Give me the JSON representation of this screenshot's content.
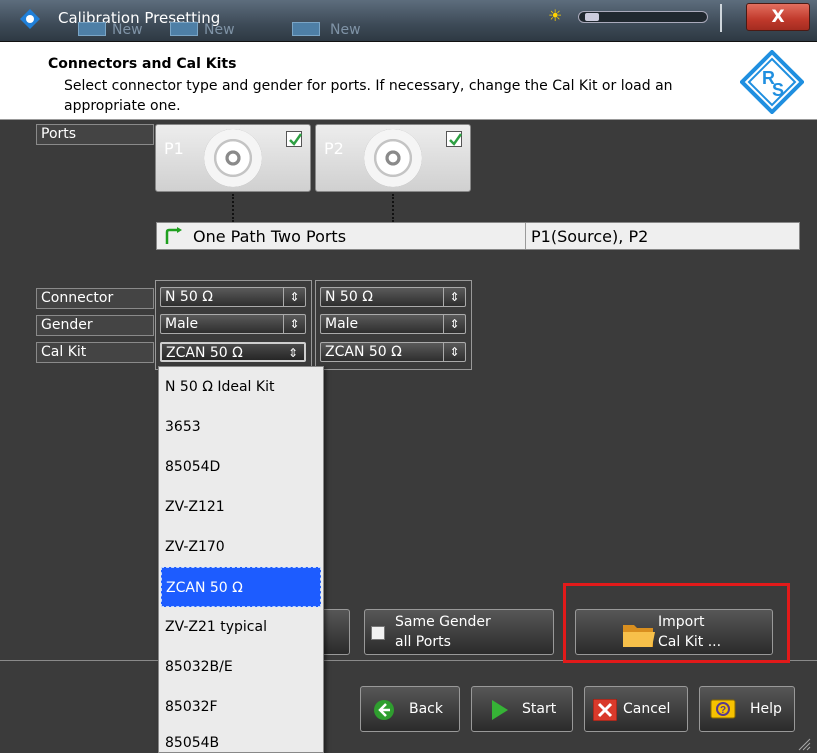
{
  "window": {
    "title": "Calibration Presetting",
    "background_tabs": [
      "New",
      "New",
      "New"
    ],
    "close_label": "X"
  },
  "header": {
    "title": "Connectors and Cal Kits",
    "description": "Select connector type and gender for ports. If necessary, change the Cal Kit or load an appropriate one."
  },
  "ports": {
    "label": "Ports",
    "items": [
      {
        "label": "P1",
        "checked": true
      },
      {
        "label": "P2",
        "checked": true
      }
    ]
  },
  "path": {
    "type": "One Path Two Ports",
    "ports": "P1(Source), P2"
  },
  "settings": {
    "connector_label": "Connector",
    "gender_label": "Gender",
    "calkit_label": "Cal Kit",
    "columns": [
      {
        "connector": "N 50 Ω",
        "gender": "Male",
        "calkit": "ZCAN 50 Ω"
      },
      {
        "connector": "N 50 Ω",
        "gender": "Male",
        "calkit": "ZCAN 50 Ω"
      }
    ]
  },
  "calkit_dropdown": {
    "options": [
      "N 50 Ω Ideal Kit",
      "3653",
      "85054D",
      "ZV-Z121",
      "ZV-Z170",
      "ZCAN 50 Ω",
      "ZV-Z21 typical",
      "85032B/E",
      "85032F",
      "85054B"
    ],
    "selected": "ZCAN 50 Ω"
  },
  "options": {
    "same_gender_line1": "Same Gender",
    "same_gender_line2": "all Ports",
    "import_line1": "Import",
    "import_line2": "Cal Kit ..."
  },
  "footer": {
    "back": "Back",
    "start": "Start",
    "cancel": "Cancel",
    "help": "Help"
  },
  "colors": {
    "highlight_box": "#e21a1a",
    "selection": "#1d5cff",
    "checkbox_check": "#2ea043"
  }
}
